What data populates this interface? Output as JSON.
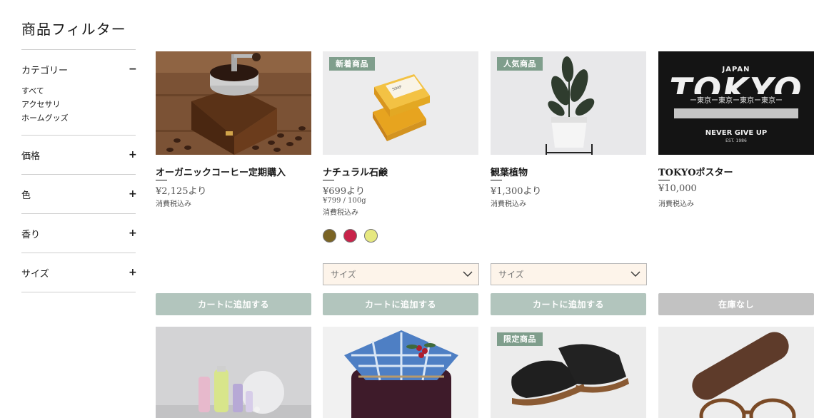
{
  "sidebar": {
    "title": "商品フィルター",
    "sections": [
      {
        "label": "カテゴリー",
        "toggle": "−",
        "items": [
          "すべて",
          "アクセサリ",
          "ホームグッズ"
        ]
      },
      {
        "label": "価格",
        "toggle": "+"
      },
      {
        "label": "色",
        "toggle": "+"
      },
      {
        "label": "香り",
        "toggle": "+"
      },
      {
        "label": "サイズ",
        "toggle": "+"
      }
    ]
  },
  "products": [
    {
      "name": "オーガニックコーヒー定期購入",
      "price": "¥2,125より",
      "tax": "消費税込み",
      "button": "カートに追加する"
    },
    {
      "name": "ナチュラル石鹸",
      "badge": "新着商品",
      "price": "¥699より",
      "unit_price": "¥799 / 100g",
      "tax": "消費税込み",
      "swatches": [
        "#7a6424",
        "#c8234a",
        "#e6e880"
      ],
      "size_placeholder": "サイズ",
      "button": "カートに追加する"
    },
    {
      "name": "観葉植物",
      "badge": "人気商品",
      "price": "¥1,300より",
      "tax": "消費税込み",
      "size_placeholder": "サイズ",
      "button": "カートに追加する"
    },
    {
      "name": "TOKYOポスター",
      "price": "¥10,000",
      "tax": "消費税込み",
      "button": "在庫なし"
    },
    {},
    {},
    {
      "badge": "限定商品"
    },
    {}
  ],
  "poster_text": {
    "top": "JAPAN",
    "main": "TOKYO",
    "band": "ー東京ー東京ー東京ー東京ー",
    "slogan": "NEVER GIVE UP",
    "est": "EST. 1986"
  },
  "soap_label": "SOAP"
}
